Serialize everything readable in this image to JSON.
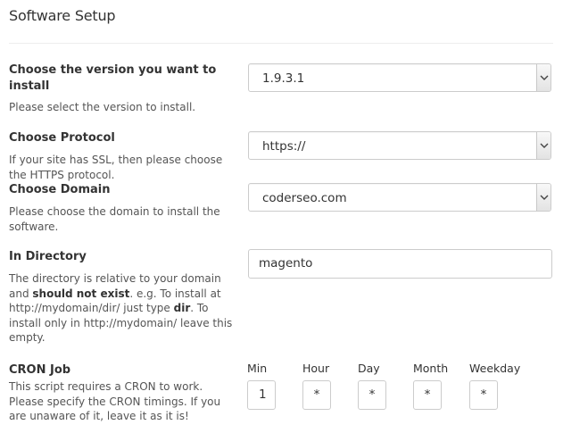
{
  "page": {
    "title": "Software Setup"
  },
  "version": {
    "label_line1": "Choose the version you want to",
    "label_line2": "install",
    "desc": "Please select the version to install.",
    "value": "1.9.3.1"
  },
  "protocol": {
    "label": "Choose Protocol",
    "desc_line1": "If your site has SSL, then please choose",
    "desc_line2": "the HTTPS protocol.",
    "value": "https://"
  },
  "domain": {
    "label": "Choose Domain",
    "desc_line1": "Please choose the domain to install the",
    "desc_line2": "software.",
    "value": "coderseo.com"
  },
  "directory": {
    "label": "In Directory",
    "desc_a": "The directory is relative to your domain",
    "desc_b1": "and ",
    "desc_b_bold": "should not exist",
    "desc_b2": ". e.g. To install at",
    "desc_c1": "http://mydomain/dir/ just type ",
    "desc_c_bold": "dir",
    "desc_c2": ". To",
    "desc_d": "install only in http://mydomain/ leave this",
    "desc_e": "empty.",
    "value": "magento"
  },
  "cron": {
    "label": "CRON Job",
    "desc_line1": "This script requires a CRON to work.",
    "desc_line2": "Please specify the CRON timings. If you",
    "desc_line3": "are unaware of it, leave it as it is!",
    "fields": [
      {
        "label": "Min",
        "value": "1"
      },
      {
        "label": "Hour",
        "value": "*"
      },
      {
        "label": "Day",
        "value": "*"
      },
      {
        "label": "Month",
        "value": "*"
      },
      {
        "label": "Weekday",
        "value": "*"
      }
    ]
  },
  "icons": {
    "dropdown": "chevron-down-icon"
  }
}
